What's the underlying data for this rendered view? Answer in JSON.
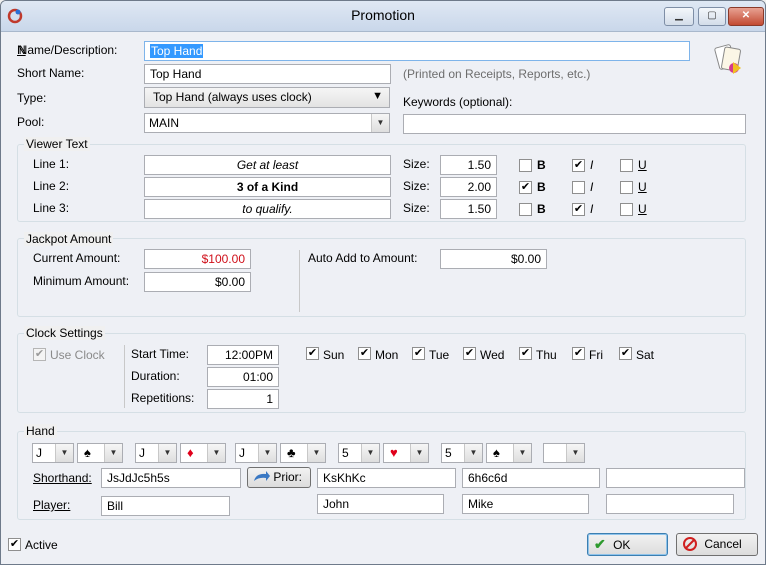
{
  "window": {
    "title": "Promotion"
  },
  "form": {
    "name_label": "Name/Description:",
    "name_value": "Top Hand",
    "short_label": "Short Name:",
    "short_value": "Top Hand",
    "short_note": "(Printed on Receipts, Reports, etc.)",
    "type_label": "Type:",
    "type_value": "Top Hand (always uses clock)",
    "keywords_label": "Keywords (optional):",
    "keywords_value": "",
    "pool_label": "Pool:",
    "pool_value": "MAIN"
  },
  "viewer_text": {
    "title": "Viewer Text",
    "size_label": "Size:",
    "lines": [
      {
        "label": "Line 1:",
        "text": "Get at least",
        "size": "1.50",
        "bold": false,
        "italic": true,
        "underline": false
      },
      {
        "label": "Line 2:",
        "text": "3 of a Kind",
        "size": "2.00",
        "bold": true,
        "italic": false,
        "underline": false
      },
      {
        "label": "Line 3:",
        "text": "to qualify.",
        "size": "1.50",
        "bold": false,
        "italic": true,
        "underline": false
      }
    ],
    "b": "B",
    "i": "I",
    "u": "U"
  },
  "jackpot": {
    "title": "Jackpot Amount",
    "current_label": "Current Amount:",
    "current_value": "$100.00",
    "minimum_label": "Minimum Amount:",
    "minimum_value": "$0.00",
    "auto_label": "Auto Add to Amount:",
    "auto_value": "$0.00"
  },
  "clock": {
    "title": "Clock Settings",
    "use_clock_label": "Use Clock",
    "use_clock": true,
    "start_label": "Start Time:",
    "start_value": "12:00PM",
    "duration_label": "Duration:",
    "duration_value": "01:00",
    "reps_label": "Repetitions:",
    "reps_value": "1",
    "days": [
      {
        "label": "Sun",
        "checked": true
      },
      {
        "label": "Mon",
        "checked": true
      },
      {
        "label": "Tue",
        "checked": true
      },
      {
        "label": "Wed",
        "checked": true
      },
      {
        "label": "Thu",
        "checked": true
      },
      {
        "label": "Fri",
        "checked": true
      },
      {
        "label": "Sat",
        "checked": true
      }
    ]
  },
  "hand": {
    "title": "Hand",
    "cards": [
      {
        "rank": "J",
        "suit": "♠",
        "suit_color": "#000000"
      },
      {
        "rank": "J",
        "suit": "♦",
        "suit_color": "#e0001b"
      },
      {
        "rank": "J",
        "suit": "♣",
        "suit_color": "#000000"
      },
      {
        "rank": "5",
        "suit": "♥",
        "suit_color": "#e0001b"
      },
      {
        "rank": "5",
        "suit": "♠",
        "suit_color": "#000000"
      }
    ],
    "shorthand_label": "Shorthand:",
    "shorthand_value": "JsJdJc5h5s",
    "prior_label": "Prior:",
    "prior_hands": [
      "KsKhKc",
      "6h6c6d",
      ""
    ],
    "player_label": "Player:",
    "player_value": "Bill",
    "prior_players": [
      "John",
      "Mike",
      ""
    ]
  },
  "footer": {
    "active_label": "Active",
    "active": true,
    "ok_label": "OK",
    "cancel_label": "Cancel"
  }
}
